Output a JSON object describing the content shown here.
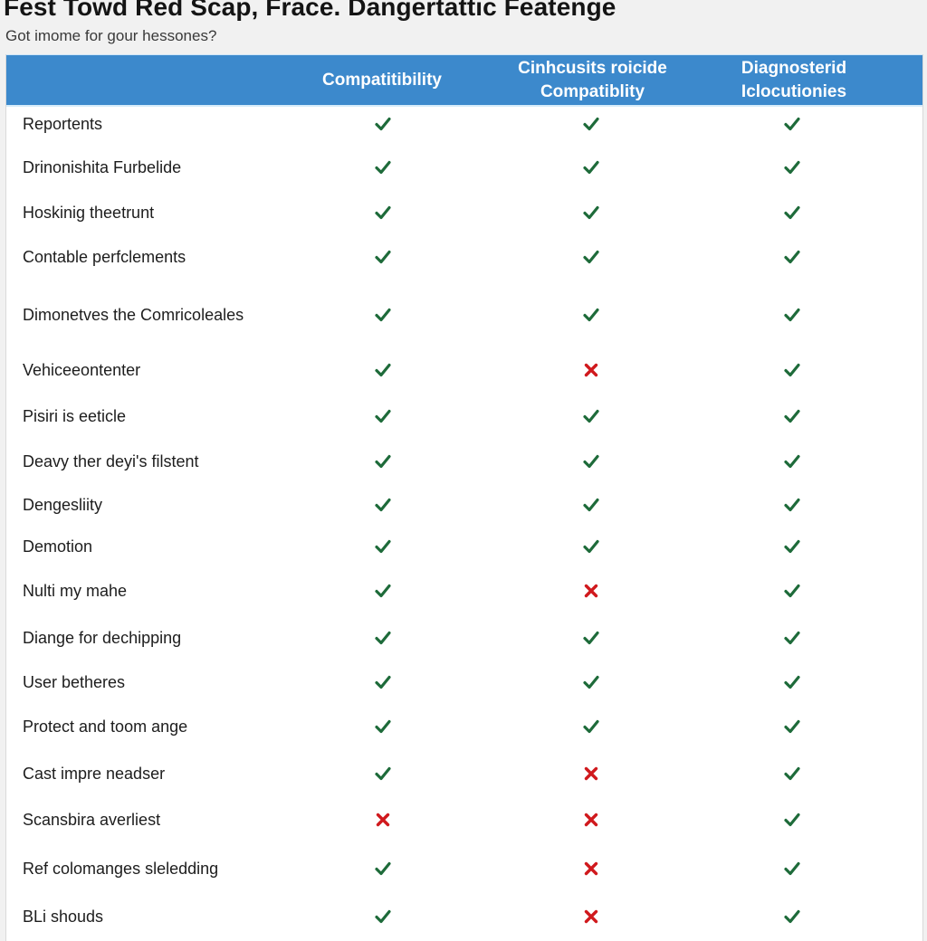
{
  "header": {
    "title": "Fest Towd Red Scap, Frace. Dangertattic Featenge",
    "subtitle": "Got imome for gour hessones?"
  },
  "table": {
    "columns": [
      {
        "label_lines": [
          "",
          ""
        ]
      },
      {
        "label_lines": [
          "Compatitibility",
          ""
        ]
      },
      {
        "label_lines": [
          "Cinhcusits roicide",
          "Compatiblity"
        ]
      },
      {
        "label_lines": [
          "Diagnosterid",
          "Iclocutionies"
        ]
      }
    ],
    "rows": [
      {
        "label": "Reportents",
        "values": [
          "check",
          "check",
          "check"
        ]
      },
      {
        "label": "Drinonishita Furbelide",
        "values": [
          "check",
          "check",
          "check"
        ]
      },
      {
        "label": "Hoskinig theetrunt",
        "values": [
          "check",
          "check",
          "check"
        ]
      },
      {
        "label": "Contable perfclements",
        "values": [
          "check",
          "check",
          "check"
        ]
      },
      {
        "label": "Dimonetves the Comricoleales",
        "values": [
          "check",
          "check",
          "check"
        ]
      },
      {
        "label": "Vehiceeontenter",
        "values": [
          "check",
          "cross",
          "check"
        ]
      },
      {
        "label": "Pisiri is eeticle",
        "values": [
          "check",
          "check",
          "check"
        ]
      },
      {
        "label": "Deavy ther deyi's filstent",
        "values": [
          "check",
          "check",
          "check"
        ]
      },
      {
        "label": "Dengesliity",
        "values": [
          "check",
          "check",
          "check"
        ]
      },
      {
        "label": "Demotion",
        "values": [
          "check",
          "check",
          "check"
        ]
      },
      {
        "label": "Nulti my mahe",
        "values": [
          "check",
          "cross",
          "check"
        ]
      },
      {
        "label": "Diange for dechipping",
        "values": [
          "check",
          "check",
          "check"
        ]
      },
      {
        "label": "User betheres",
        "values": [
          "check",
          "check",
          "check"
        ]
      },
      {
        "label": "Protect and toom ange",
        "values": [
          "check",
          "check",
          "check"
        ]
      },
      {
        "label": "Cast impre neadser",
        "values": [
          "check",
          "cross",
          "check"
        ]
      },
      {
        "label": "Scansbira averliest",
        "values": [
          "cross",
          "cross",
          "check"
        ]
      },
      {
        "label": "Ref colomanges sleledding",
        "values": [
          "check",
          "cross",
          "check"
        ]
      },
      {
        "label": "BLi shouds",
        "values": [
          "check",
          "cross",
          "check"
        ]
      }
    ]
  },
  "icons": {
    "check": "check-icon",
    "cross": "cross-icon"
  },
  "colors": {
    "header_bg": "#3c89cc",
    "check": "#1e6b3a",
    "cross": "#d0191d"
  }
}
